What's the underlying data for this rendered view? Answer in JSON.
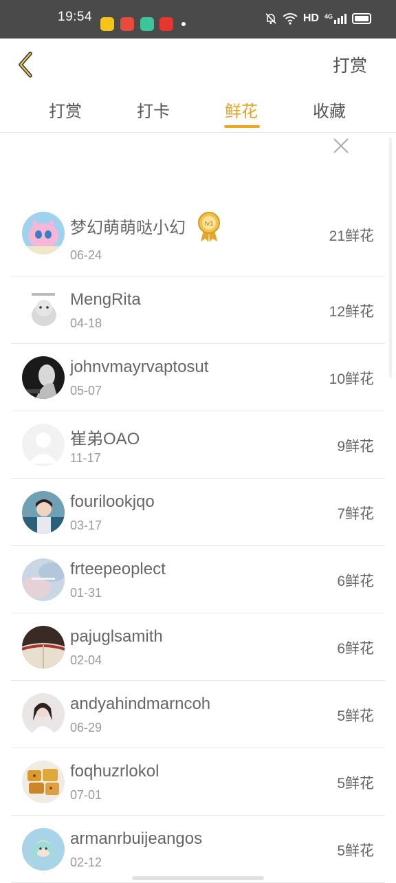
{
  "status": {
    "time": "19:54",
    "network": "HD",
    "signal_label": "4G"
  },
  "header": {
    "action": "打赏"
  },
  "tabs": [
    {
      "label": "打赏"
    },
    {
      "label": "打卡"
    },
    {
      "label": "鲜花",
      "active": true
    },
    {
      "label": "收藏"
    }
  ],
  "list": [
    {
      "name": "梦幻萌萌哒小幻",
      "date": "06-24",
      "count": "21鲜花",
      "badge": "lv1",
      "avatar": "pink-cat"
    },
    {
      "name": "MengRita",
      "date": "04-18",
      "count": "12鲜花",
      "avatar": "hamster"
    },
    {
      "name": "johnvmayrvaptosut",
      "date": "05-07",
      "count": "10鲜花",
      "avatar": "dark-figure"
    },
    {
      "name": "崔弟OAO",
      "date": "11-17",
      "count": "9鲜花",
      "avatar": "default"
    },
    {
      "name": "fourilookjqo",
      "date": "03-17",
      "count": "7鲜花",
      "avatar": "girl-blue"
    },
    {
      "name": "frteepeoplect",
      "date": "01-31",
      "count": "6鲜花",
      "avatar": "sky"
    },
    {
      "name": "pajuglsamith",
      "date": "02-04",
      "count": "6鲜花",
      "avatar": "book"
    },
    {
      "name": "andyahindmarncoh",
      "date": "06-29",
      "count": "5鲜花",
      "avatar": "girl-white"
    },
    {
      "name": "foqhuzrlokol",
      "date": "07-01",
      "count": "5鲜花",
      "avatar": "food"
    },
    {
      "name": "armanrbuijeangos",
      "date": "02-12",
      "count": "5鲜花",
      "avatar": "anime"
    }
  ],
  "colors": {
    "accent": "#f0a61d",
    "status_bar": "#4a4a4a"
  }
}
